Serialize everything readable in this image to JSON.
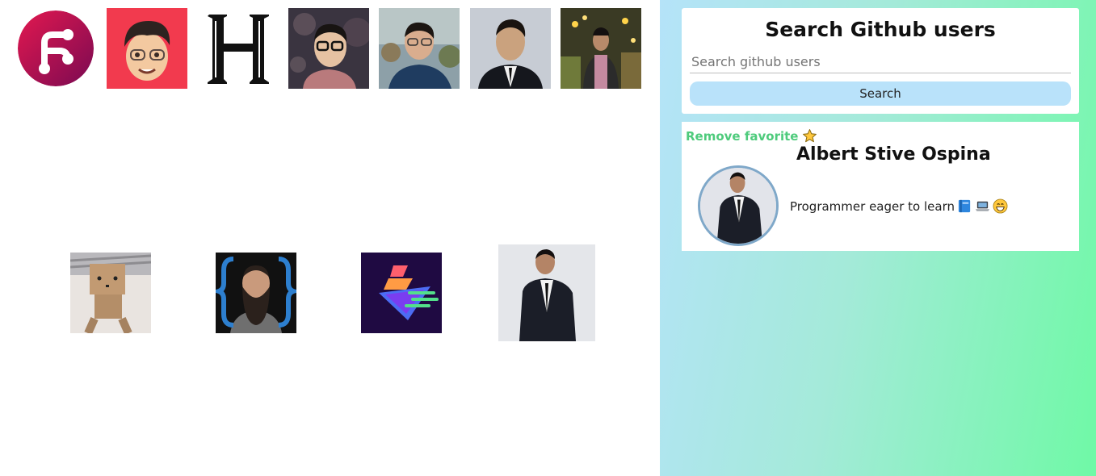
{
  "top_row_avatars": [
    {
      "icon": "pink-fork-logo-icon"
    },
    {
      "icon": "memoji-avatar"
    },
    {
      "icon": "gothic-letter-logo"
    },
    {
      "icon": "man-glasses-space-avatar"
    },
    {
      "icon": "man-outdoors-avatar"
    },
    {
      "icon": "man-suit-avatar"
    },
    {
      "icon": "man-carnival-avatar"
    }
  ],
  "bottom_row_avatars": [
    {
      "icon": "cardboard-robot-avatar"
    },
    {
      "icon": "bearded-braces-avatar"
    },
    {
      "icon": "purple-gradient-logo"
    },
    {
      "icon": "man-suit-profile-avatar"
    }
  ],
  "search": {
    "title": "Search Github users",
    "placeholder": "Search github users",
    "value": "",
    "button_label": "Search"
  },
  "favorite": {
    "remove_label": "Remove favorite",
    "remove_icon": "star-icon",
    "name": "Albert Stive Ospina",
    "bio": "Programmer eager to learn",
    "bio_emojis": [
      "book-icon",
      "laptop-icon",
      "grinning-face-icon"
    ]
  },
  "colors": {
    "remove_favorite": "#4ecb7c",
    "search_button": "#b9e2fa",
    "gradient_start": "#b5e3f9",
    "gradient_end": "#6ff9a6",
    "avatar_border": "#7fa8c9"
  }
}
